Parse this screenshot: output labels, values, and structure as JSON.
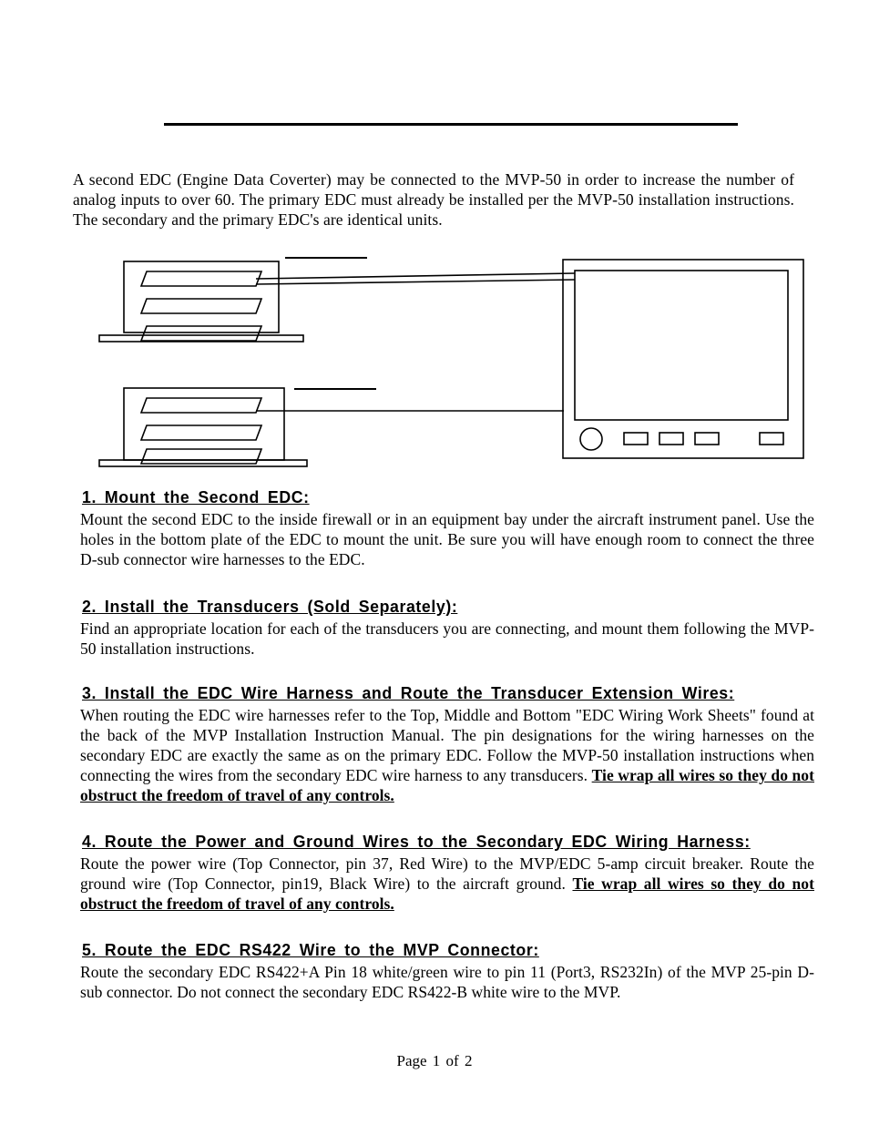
{
  "document": {
    "intro": "A second EDC (Engine Data Coverter) may be connected to the MVP-50 in order to increase the number of analog inputs to over 60.  The primary EDC must already be installed per the MVP-50 installation instructions.  The secondary and the primary EDC's are identical units.",
    "footer": "Page 1 of 2"
  },
  "diagram": {
    "upper_edc": {
      "name": "secondary-edc-unit",
      "connector_count": 3,
      "wire_count": 2,
      "label_text": ""
    },
    "lower_edc": {
      "name": "primary-edc-unit",
      "connector_count": 3,
      "wire_count": 1,
      "label_text": ""
    },
    "display": {
      "name": "mvp-50-display",
      "knob_count": 1,
      "button_count": 4
    }
  },
  "sections": [
    {
      "heading": "1.   Mount the Second EDC:",
      "body_parts": [
        {
          "text": "Mount the second EDC to the inside firewall or in an equipment bay under the aircraft instrument panel.  Use the holes in the bottom plate of the EDC to mount the unit.  Be sure you will have enough room to connect the three D-sub connector wire harnesses to the EDC.",
          "emphasis": false
        }
      ]
    },
    {
      "heading": "2.   Install the Transducers (Sold Separately):",
      "body_parts": [
        {
          "text": "Find an appropriate location for each of the transducers you are connecting, and mount them following the MVP-50 installation instructions.",
          "emphasis": false
        }
      ]
    },
    {
      "heading": "3.   Install the EDC Wire Harness and Route the Transducer Extension Wires:",
      "body_parts": [
        {
          "text": "When routing the EDC wire harnesses refer to the Top, Middle and Bottom \"EDC Wiring Work Sheets\" found at the back of the MVP Installation Instruction Manual.  The pin designations for the wiring harnesses on the secondary EDC are exactly the same as on the primary EDC.   Follow the MVP-50 installation instructions when connecting the wires from the secondary EDC wire harness to any transducers. ",
          "emphasis": false
        },
        {
          "text": "Tie wrap all wires so they do not obstruct the freedom of travel of any controls.",
          "emphasis": true
        }
      ]
    },
    {
      "heading": "4.   Route the Power and Ground Wires to the Secondary EDC Wiring Harness:",
      "body_parts": [
        {
          "text": "Route the power wire (Top Connector, pin 37, Red Wire) to the MVP/EDC 5-amp circuit breaker.  Route the ground wire (Top Connector, pin19, Black Wire) to the aircraft ground.    ",
          "emphasis": false
        },
        {
          "text": "Tie wrap all wires so they do not obstruct the freedom of travel of any controls.",
          "emphasis": true
        }
      ]
    },
    {
      "heading": "5.   Route the EDC RS422 Wire to the MVP Connector:",
      "body_parts": [
        {
          "text": "Route the secondary EDC RS422+A Pin 18 white/green wire to pin 11 (Port3, RS232In) of the MVP 25-pin D-sub connector.  Do not connect the secondary EDC RS422-B white wire to the MVP.",
          "emphasis": false
        }
      ]
    }
  ],
  "colors": {
    "ink": "#000000",
    "paper": "#ffffff"
  }
}
